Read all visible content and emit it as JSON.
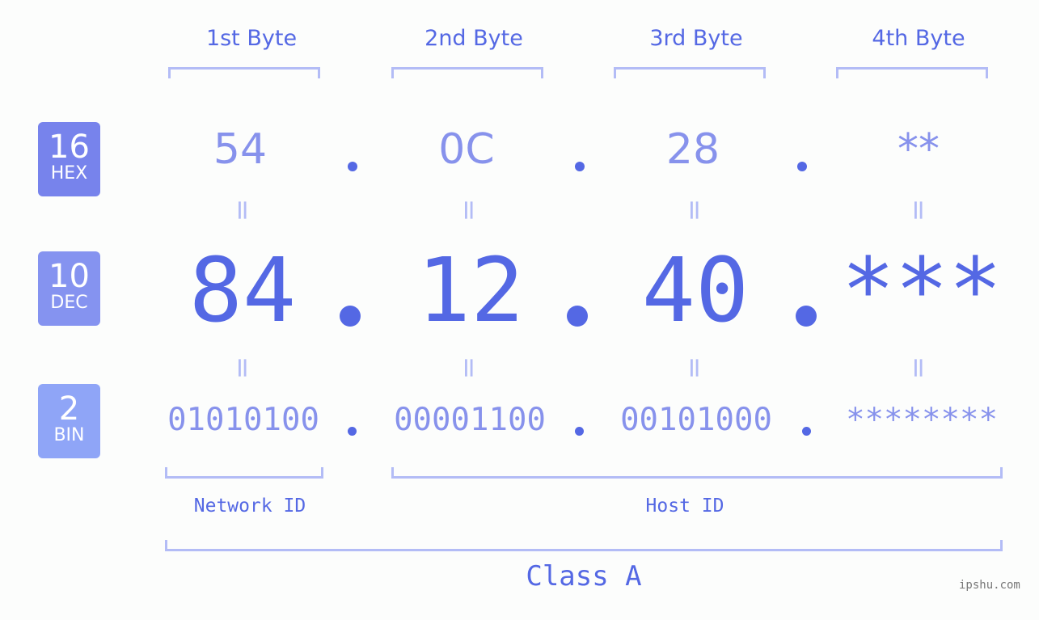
{
  "headers": [
    "1st Byte",
    "2nd Byte",
    "3rd Byte",
    "4th Byte"
  ],
  "bases": [
    {
      "num": "16",
      "label": "HEX",
      "color": "#7783ec"
    },
    {
      "num": "10",
      "label": "DEC",
      "color": "#8593f0"
    },
    {
      "num": "2",
      "label": "BIN",
      "color": "#8fa5f7"
    }
  ],
  "hex": [
    "54",
    "0C",
    "28",
    "**"
  ],
  "dec": [
    "84",
    "12",
    "40",
    "***"
  ],
  "bin": [
    "01010100",
    "00001100",
    "00101000",
    "********"
  ],
  "equals": "=",
  "network_label": "Network ID",
  "host_label": "Host ID",
  "class_label": "Class A",
  "watermark": "ipshu.com"
}
